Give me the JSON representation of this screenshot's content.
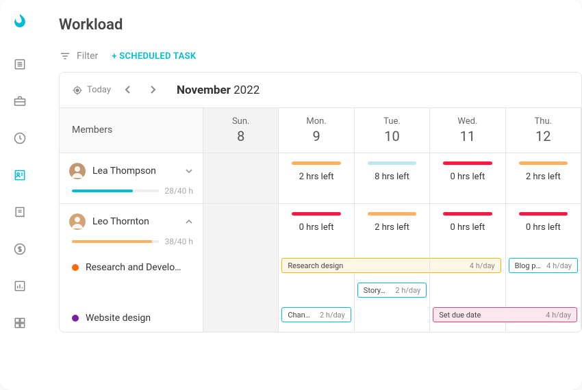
{
  "page": {
    "title": "Workload"
  },
  "toolbar": {
    "filter": "Filter",
    "scheduled": "+ SCHEDULED TASK"
  },
  "dateNav": {
    "today": "Today",
    "monthBold": "November",
    "year": "2022"
  },
  "headers": {
    "members": "Members"
  },
  "days": [
    {
      "short": "Sun.",
      "num": "8"
    },
    {
      "short": "Mon.",
      "num": "9"
    },
    {
      "short": "Tue.",
      "num": "10"
    },
    {
      "short": "Wed.",
      "num": "11"
    },
    {
      "short": "Thu.",
      "num": "12"
    }
  ],
  "members": [
    {
      "name": "Lea Thompson",
      "hours": "28/40 h",
      "barColor": "#00bcd4",
      "barPct": 70,
      "expanded": false,
      "days": [
        null,
        {
          "left": "2 hrs left",
          "color": "#ffb061"
        },
        {
          "left": "8 hrs left",
          "color": "#bfe7ef"
        },
        {
          "left": "0 hrs left",
          "color": "#ff1744"
        },
        {
          "left": "2 hrs left",
          "color": "#ffb061"
        }
      ]
    },
    {
      "name": "Leo Thornton",
      "hours": "38/40 h",
      "barColor": "#ffb061",
      "barPct": 92,
      "expanded": true,
      "days": [
        null,
        {
          "left": "0 hrs left",
          "color": "#ff1744"
        },
        {
          "left": "2 hrs left",
          "color": "#ffb061"
        },
        {
          "left": "0 hrs left",
          "color": "#ff1744"
        },
        {
          "left": "0 hrs left",
          "color": "#ff1744"
        }
      ],
      "projects": [
        {
          "name": "Research and Develo…",
          "color": "#ff6b00"
        },
        {
          "name": "Website design",
          "color": "#7b1fa2"
        }
      ]
    }
  ],
  "tasks": [
    {
      "name": "Research design",
      "hrs": "4 h/day",
      "color": "#ffb300",
      "bg": "#fff8e6",
      "startCol": 1,
      "span": 3,
      "row": 0
    },
    {
      "name": "Blog p…",
      "hrs": "4 h/day",
      "color": "#00bcd4",
      "bg": "#fff",
      "startCol": 4,
      "span": 1,
      "row": 0
    },
    {
      "name": "Story…",
      "hrs": "2 h/day",
      "color": "#00bcd4",
      "bg": "#fff",
      "startCol": 2,
      "span": 1,
      "row": 1
    },
    {
      "name": "Chang…",
      "hrs": "2 h/day",
      "color": "#00bcd4",
      "bg": "#fff",
      "startCol": 1,
      "span": 1,
      "row": 2
    },
    {
      "name": "Set due date",
      "hrs": "4 h/day",
      "color": "#ec407a",
      "bg": "#fde7ef",
      "startCol": 3,
      "span": 2,
      "row": 2
    }
  ]
}
